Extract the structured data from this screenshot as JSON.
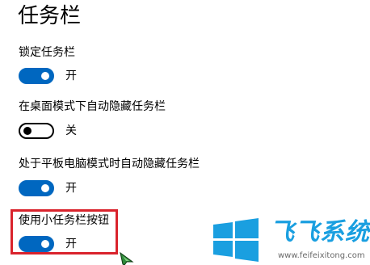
{
  "page": {
    "title": "任务栏"
  },
  "settings": [
    {
      "label": "锁定任务栏",
      "state": "开",
      "enabled": true
    },
    {
      "label": "在桌面模式下自动隐藏任务栏",
      "state": "关",
      "enabled": false
    },
    {
      "label": "处于平板电脑模式时自动隐藏任务栏",
      "state": "开",
      "enabled": true
    },
    {
      "label": "使用小任务栏按钮",
      "state": "开",
      "enabled": true
    }
  ],
  "colors": {
    "accent": "#0067c0",
    "highlight": "#d9232c",
    "brand": "#1a9fe0"
  },
  "watermark": {
    "icon": "windows-logo-icon",
    "text": "飞飞系统",
    "url": "www.feifeixitong.com"
  }
}
